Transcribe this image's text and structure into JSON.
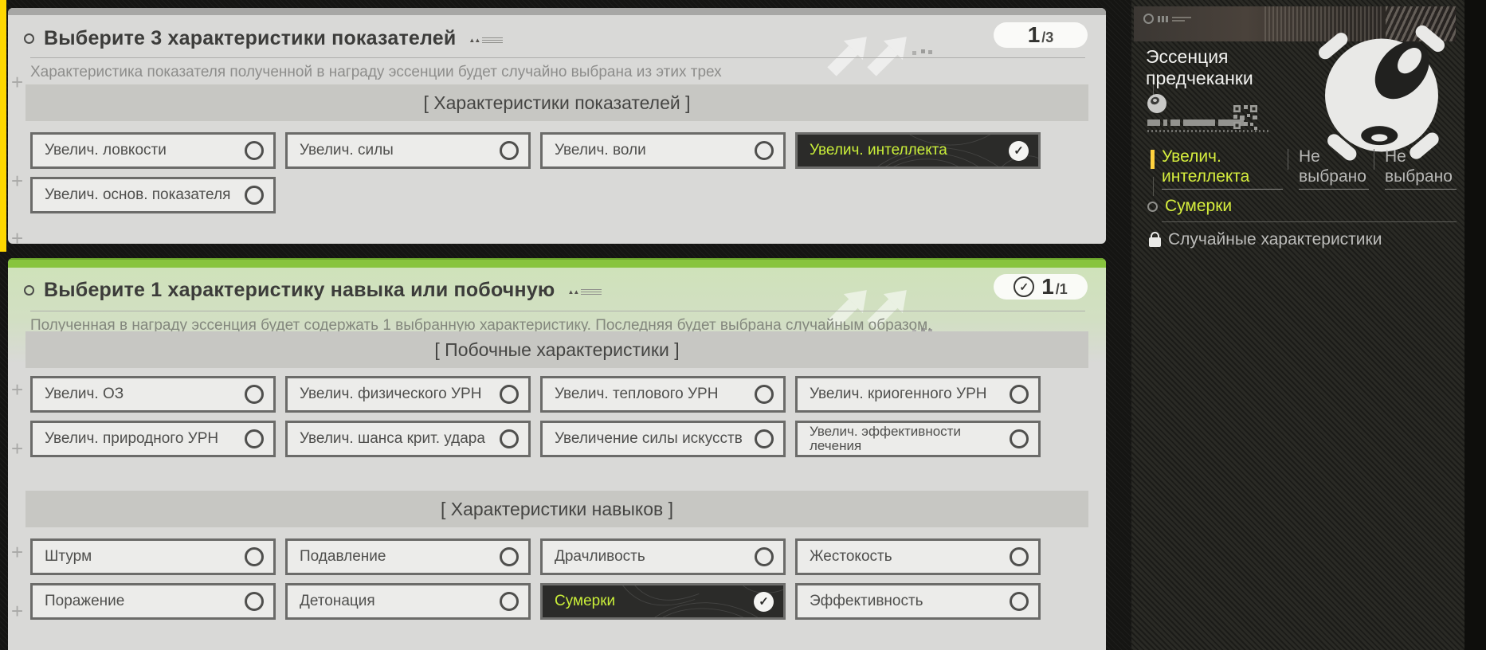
{
  "colors": {
    "accent_green": "#88c43e",
    "select_highlight": "#c9ee39",
    "accent_yellow": "#ffd800",
    "panel_bg": "#d9d9d7",
    "selected_bg": "#2b2b29"
  },
  "icons": {
    "check": "✓",
    "stamp_triangles": "▲▲"
  },
  "panel1": {
    "title": "Выберите 3 характеристики показателей",
    "counter": {
      "current": "1",
      "total": "/3"
    },
    "subtitle": "Характеристика показателя полученной в награду эссенции будет случайно выбрана из этих трех",
    "section_header": "[  Характеристики показателей  ]",
    "options": [
      {
        "label": "Увелич. ловкости",
        "selected": false
      },
      {
        "label": "Увелич. силы",
        "selected": false
      },
      {
        "label": "Увелич. воли",
        "selected": false
      },
      {
        "label": "Увелич. интеллекта",
        "selected": true
      },
      {
        "label": "Увелич. основ. показателя",
        "selected": false
      }
    ]
  },
  "panel2": {
    "title": "Выберите 1 характеристику навыка или побочную",
    "counter": {
      "current": "1",
      "total": "/1"
    },
    "subtitle": "Полученная в награду эссенция будет содержать 1 выбранную характеристику. Последняя будет выбрана случайным образом.",
    "sections": [
      {
        "header": "[  Побочные характеристики  ]",
        "options": [
          {
            "label": "Увелич. ОЗ",
            "selected": false
          },
          {
            "label": "Увелич. физического УРН",
            "selected": false
          },
          {
            "label": "Увелич. теплового УРН",
            "selected": false
          },
          {
            "label": "Увелич. криогенного УРН",
            "selected": false
          },
          {
            "label": "Увелич. природного УРН",
            "selected": false
          },
          {
            "label": "Увелич. шанса крит. удара",
            "selected": false
          },
          {
            "label": "Увеличение силы искусств",
            "selected": false
          },
          {
            "label": "Увелич. эффективности лечения",
            "selected": false
          }
        ]
      },
      {
        "header": "[  Характеристики навыков  ]",
        "options": [
          {
            "label": "Штурм",
            "selected": false
          },
          {
            "label": "Подавление",
            "selected": false
          },
          {
            "label": "Драчливость",
            "selected": false
          },
          {
            "label": "Жестокость",
            "selected": false
          },
          {
            "label": "Поражение",
            "selected": false
          },
          {
            "label": "Детонация",
            "selected": false
          },
          {
            "label": "Сумерки",
            "selected": true
          },
          {
            "label": "Эффективность",
            "selected": false
          }
        ]
      }
    ]
  },
  "sidebar": {
    "title": "Эссенция предчеканки",
    "slots": [
      {
        "label": "Увелич. интеллекта",
        "state": "selected"
      },
      {
        "label": "Не выбрано",
        "state": "empty"
      },
      {
        "label": "Не выбрано",
        "state": "empty"
      }
    ],
    "skill": "Сумерки",
    "locked_label": "Случайные характеристики"
  }
}
